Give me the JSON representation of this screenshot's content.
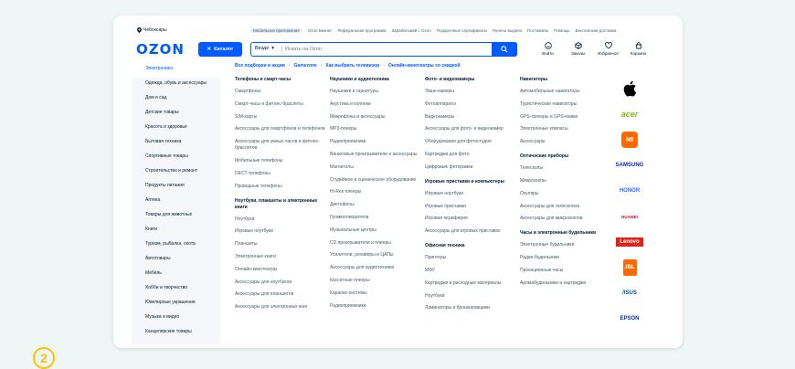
{
  "city": "Чебоксары",
  "top_links": [
    "Мобильное приложение",
    "Ozon Бизнес",
    "Реферальная программа",
    "Зарабатывай с Ozon",
    "Подарочные сертификаты",
    "Пункты выдачи",
    "Постаматы",
    "Помощь",
    "Бесплатная доставка"
  ],
  "logo": "OZON",
  "catalog_label": "Каталог",
  "search": {
    "scope": "Везде",
    "placeholder": "Искать на Ozon"
  },
  "user_icons": [
    {
      "label": "Войти",
      "icon": "user-icon"
    },
    {
      "label": "Заказы",
      "icon": "box-icon"
    },
    {
      "label": "Избранное",
      "icon": "heart-icon"
    },
    {
      "label": "Корзина",
      "icon": "cart-icon"
    }
  ],
  "sidebar": [
    "Электроника",
    "Одежда, обувь и аксессуары",
    "Дом и сад",
    "Детские товары",
    "Красота и здоровье",
    "Бытовая техника",
    "Спортивные товары",
    "Строительство и ремонт",
    "Продукты питания",
    "Аптека",
    "Товары для животных",
    "Книги",
    "Туризм, рыбалка, охота",
    "Автотовары",
    "Мебель",
    "Хобби и творчество",
    "Ювелирные украшения",
    "Музыка и видео",
    "Канцелярские товары"
  ],
  "quick_links": [
    "Все подборки и акции",
    "Gamezone",
    "Как выбрать телевизор",
    "Онлайн-кинотеатры со скидкой"
  ],
  "columns": [
    [
      {
        "h": "Телефоны и смарт-часы"
      },
      {
        "i": "Смартфоны"
      },
      {
        "i": "Смарт-часы и фитнес-браслеты"
      },
      {
        "i": "SIM-карты"
      },
      {
        "i": "Аксессуары для смартфонов и телефонов"
      },
      {
        "i": "Аксессуары для умных часов и фитнес-браслетов"
      },
      {
        "i": "Мобильные телефоны"
      },
      {
        "i": "DECT-телефоны"
      },
      {
        "i": "Проводные телефоны"
      },
      {
        "h": "Ноутбуки, планшеты и электронные книги"
      },
      {
        "i": "Ноутбуки"
      },
      {
        "i": "Игровые ноутбуки"
      },
      {
        "i": "Планшеты"
      },
      {
        "i": "Электронные книги"
      },
      {
        "i": "Онлайн-кинотеатры"
      },
      {
        "i": "Аксессуары для ноутбуков"
      },
      {
        "i": "Аксессуары для планшетов"
      },
      {
        "i": "Аксессуары для электронных книг"
      }
    ],
    [
      {
        "h": "Наушники и аудиотехника"
      },
      {
        "i": "Наушники и гарнитуры"
      },
      {
        "i": "Акустика и колонки"
      },
      {
        "i": "Микрофоны и аксессуары"
      },
      {
        "i": "MP3-плееры"
      },
      {
        "i": "Радиоприемники"
      },
      {
        "i": "Виниловые проигрыватели и аксессуары"
      },
      {
        "i": "Магнитолы"
      },
      {
        "i": "Студийное и сценическое оборудование"
      },
      {
        "i": "Hi-Res плееры"
      },
      {
        "i": "Диктофоны"
      },
      {
        "i": "Громкоговорители"
      },
      {
        "i": "Музыкальные центры"
      },
      {
        "i": "CD проигрыватели и плееры"
      },
      {
        "i": "Усилители, ресиверы и ЦАПы"
      },
      {
        "i": "Аксессуары для аудиотехники"
      },
      {
        "i": "Кассетные плееры"
      },
      {
        "i": "Караоке-системы"
      },
      {
        "i": "Радиоприемники"
      }
    ],
    [
      {
        "h": "Фото- и видеокамеры"
      },
      {
        "i": "Экшн-камеры"
      },
      {
        "i": "Фотоаппараты"
      },
      {
        "i": "Видеокамеры"
      },
      {
        "i": "Аксессуары для фото- и видеокамер"
      },
      {
        "i": "Оборудование для фотостудии"
      },
      {
        "i": "Картриджи для фото"
      },
      {
        "i": "Цифровые фоторамки"
      },
      {
        "h": "Игровые приставки и компьютеры"
      },
      {
        "i": "Игровые ноутбуки"
      },
      {
        "i": "Игровые приставки"
      },
      {
        "i": "Игровая периферия"
      },
      {
        "i": "Аксессуары для игровых приставок"
      },
      {
        "h": "Офисная техника"
      },
      {
        "i": "Принтеры"
      },
      {
        "i": "МФУ"
      },
      {
        "i": "Картриджи и расходные материалы"
      },
      {
        "i": "Ноутбуки"
      },
      {
        "i": "Ламинаторы и брошюровщики"
      }
    ],
    [
      {
        "h": "Навигаторы"
      },
      {
        "i": "Автомобильные навигаторы"
      },
      {
        "i": "Туристические навигаторы"
      },
      {
        "i": "GPS-трекеры и GPS-маяки"
      },
      {
        "i": "Электронные компасы"
      },
      {
        "i": "Аксессуары"
      },
      {
        "h": "Оптические приборы"
      },
      {
        "i": "Телескопы"
      },
      {
        "i": "Микроскопы"
      },
      {
        "i": "Окуляры"
      },
      {
        "i": "Аксессуары для телескопов"
      },
      {
        "i": "Аксессуары для микроскопов"
      },
      {
        "h": "Часы и электронные будильники"
      },
      {
        "i": "Электронные будильники"
      },
      {
        "i": "Радио-будильники"
      },
      {
        "i": "Проекционные часы"
      },
      {
        "i": "Аромабудильники и картриджи"
      }
    ]
  ],
  "brands": [
    {
      "name": "Apple",
      "text": "",
      "color": "#000000",
      "icon": "apple-logo-icon"
    },
    {
      "name": "acer",
      "text": "acer",
      "color": "#83b81a"
    },
    {
      "name": "Xiaomi",
      "text": "MI",
      "color": "#ff6900"
    },
    {
      "name": "Samsung",
      "text": "SAMSUNG",
      "color": "#1428a0"
    },
    {
      "name": "Honor",
      "text": "HONOR",
      "color": "#2f6bff"
    },
    {
      "name": "Huawei",
      "text": "HUAWEI",
      "color": "#cf0a2c"
    },
    {
      "name": "Lenovo",
      "text": "Lenovo",
      "color": "#e2231a"
    },
    {
      "name": "JBL",
      "text": "JBL",
      "color": "#ff6a00"
    },
    {
      "name": "ASUS",
      "text": "/ISUS",
      "color": "#00539b"
    },
    {
      "name": "Epson",
      "text": "EPSON",
      "color": "#003399"
    }
  ],
  "step_badge": "2"
}
